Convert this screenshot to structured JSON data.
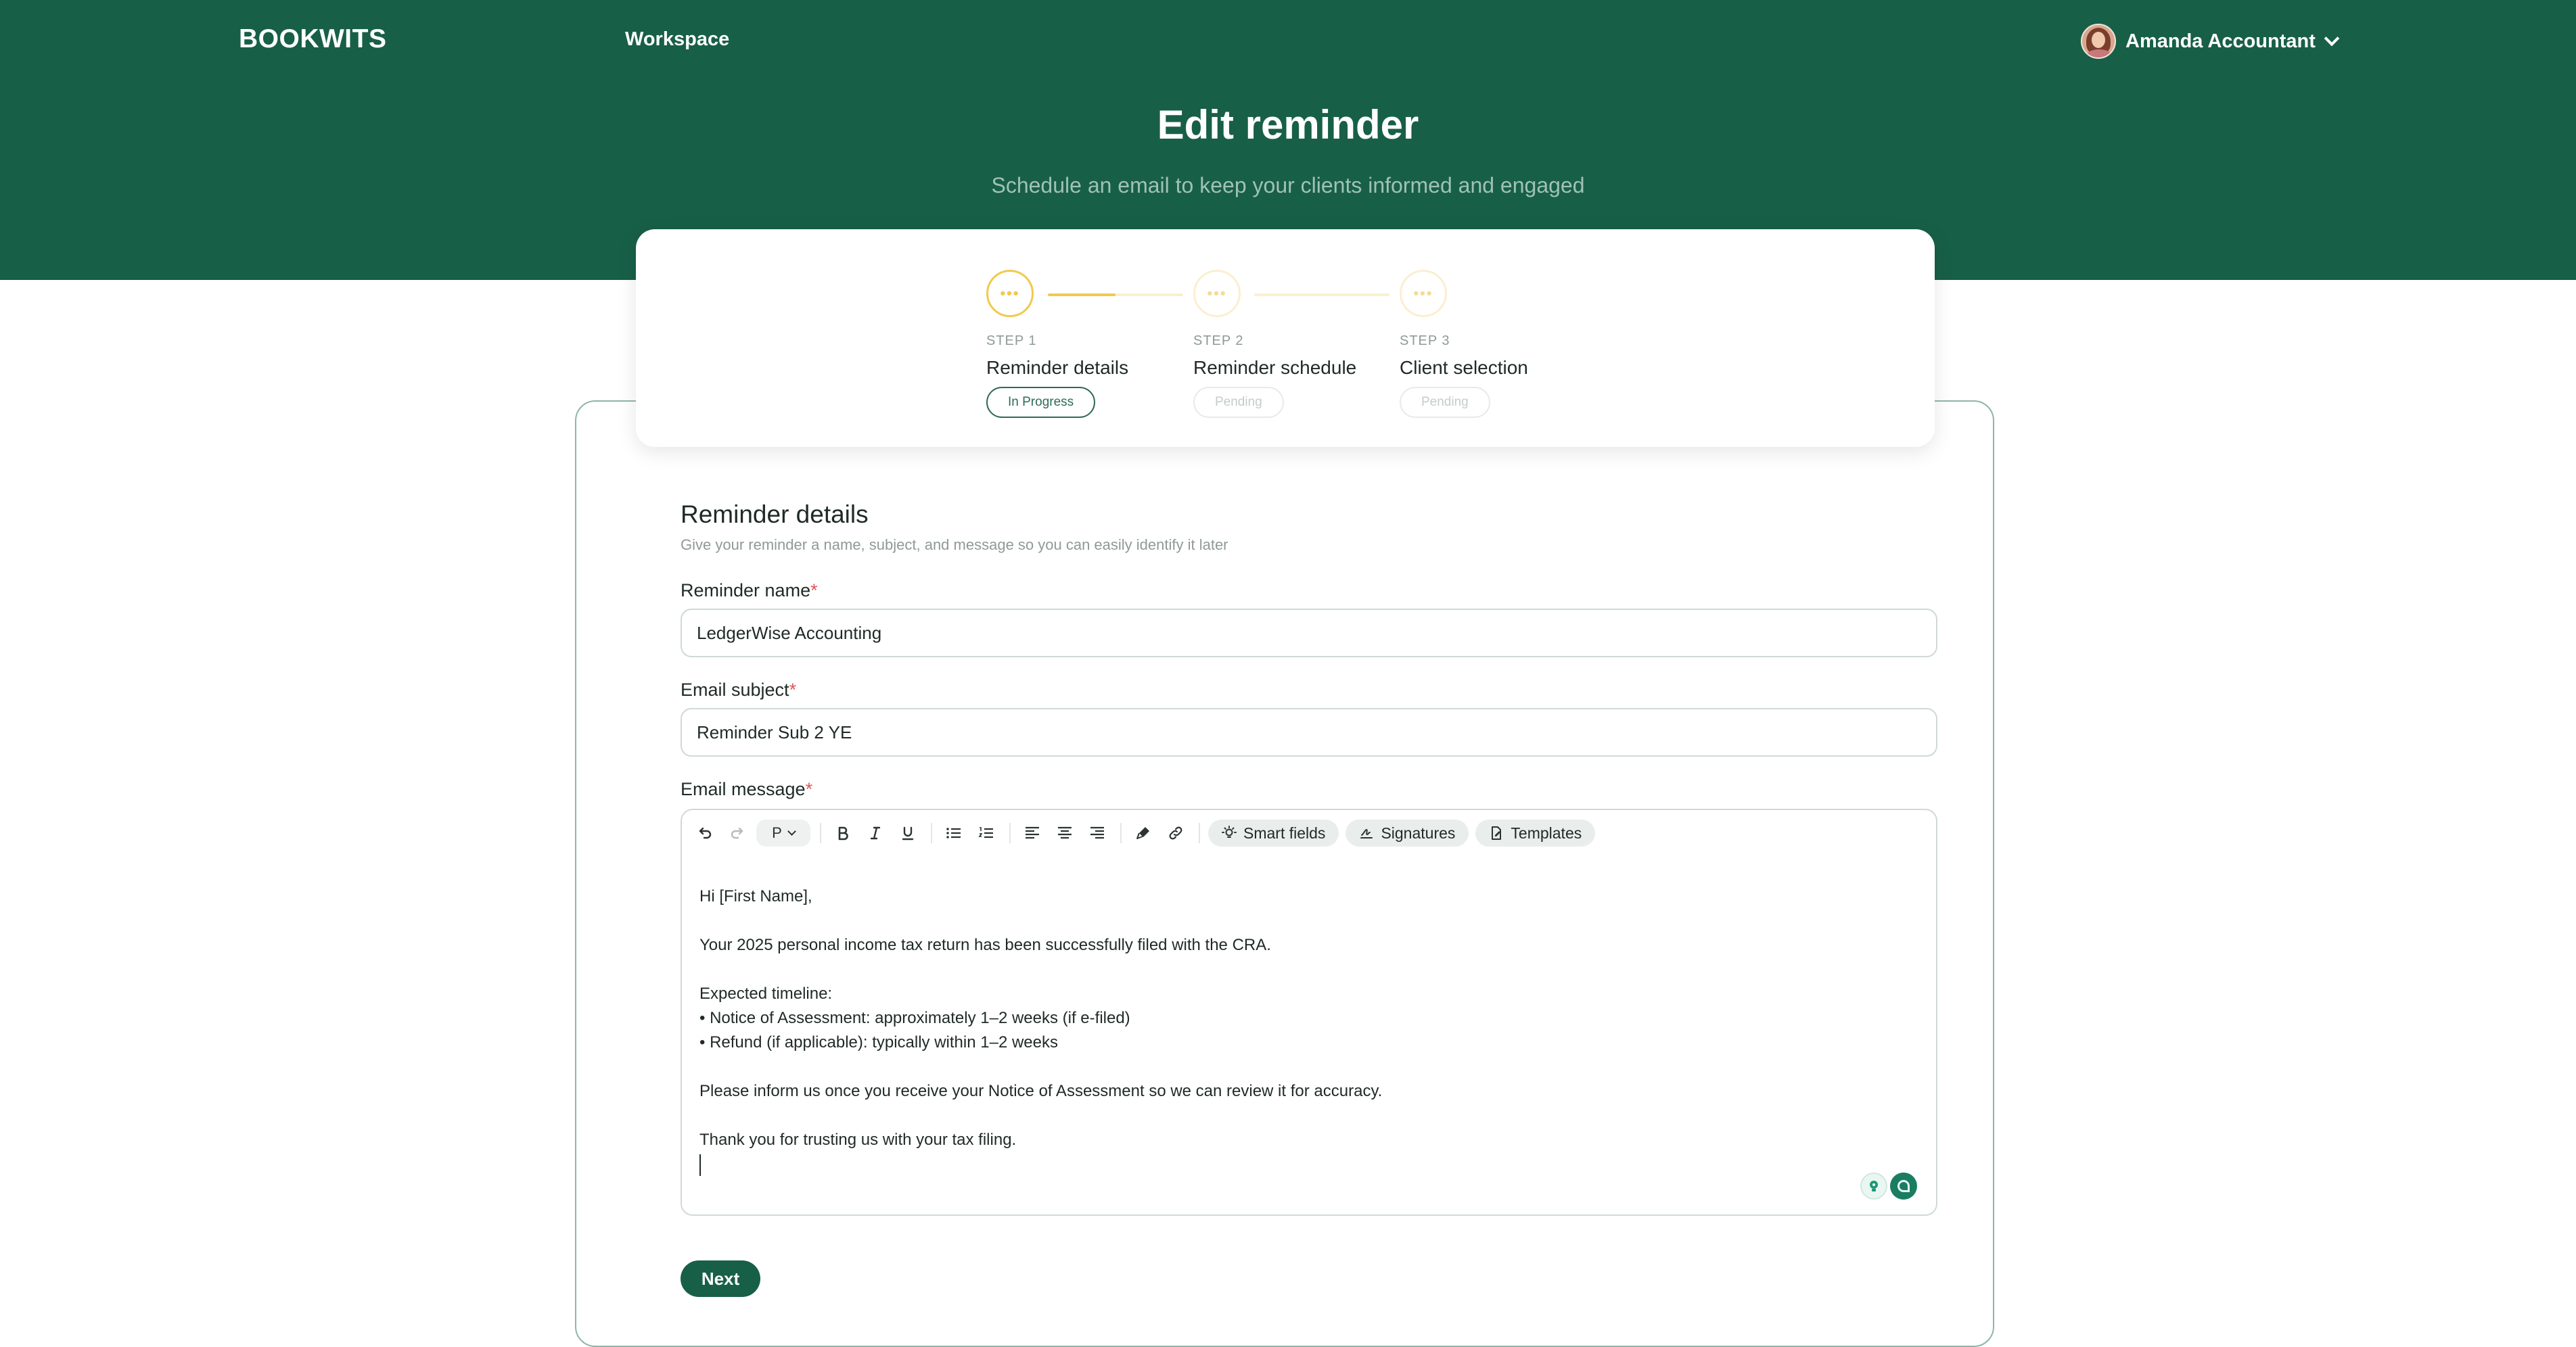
{
  "header": {
    "brand": "BOOKWITS",
    "nav_workspace": "Workspace",
    "user_name": "Amanda Accountant",
    "title": "Edit reminder",
    "subtitle": "Schedule an email to keep your clients informed and engaged"
  },
  "steps": [
    {
      "step_label": "STEP 1",
      "title": "Reminder details",
      "status": "In Progress",
      "circle": "•••",
      "connector_progress": 0.5
    },
    {
      "step_label": "STEP 2",
      "title": "Reminder schedule",
      "status": "Pending",
      "circle": "•••",
      "connector_progress": 0
    },
    {
      "step_label": "STEP 3",
      "title": "Client selection",
      "status": "Pending",
      "circle": "•••"
    }
  ],
  "form": {
    "section_title": "Reminder details",
    "section_desc": "Give your reminder a name, subject, and message so you can easily identify it later",
    "name_label": "Reminder name",
    "name_value": "LedgerWise Accounting",
    "subject_label": "Email subject",
    "subject_value": "Reminder Sub 2 YE",
    "message_label": "Email message",
    "required_mark": "*"
  },
  "editor": {
    "block_format": "P",
    "chips": {
      "smart_fields": "Smart fields",
      "signatures": "Signatures",
      "templates": "Templates"
    },
    "body": "Hi [First Name],\n\nYour 2025 personal income tax return has been successfully filed with the CRA.\n\nExpected timeline:\n• Notice of Assessment: approximately 1–2 weeks (if e-filed)\n• Refund (if applicable): typically within 1–2 weeks\n\nPlease inform us once you receive your Notice of Assessment so we can review it for accuracy.\n\nThank you for trusting us with your tax filing."
  },
  "actions": {
    "next": "Next"
  },
  "colors": {
    "brand": "#185f48",
    "step_accent": "#f2c94c",
    "required": "#e05656"
  },
  "icons": [
    "undo-icon",
    "redo-icon",
    "bold-icon",
    "italic-icon",
    "underline-icon",
    "bullet-list-icon",
    "numbered-list-icon",
    "align-left-icon",
    "align-center-icon",
    "align-right-icon",
    "highlighter-icon",
    "link-icon",
    "lightbulb-icon",
    "signature-icon",
    "template-icon"
  ]
}
